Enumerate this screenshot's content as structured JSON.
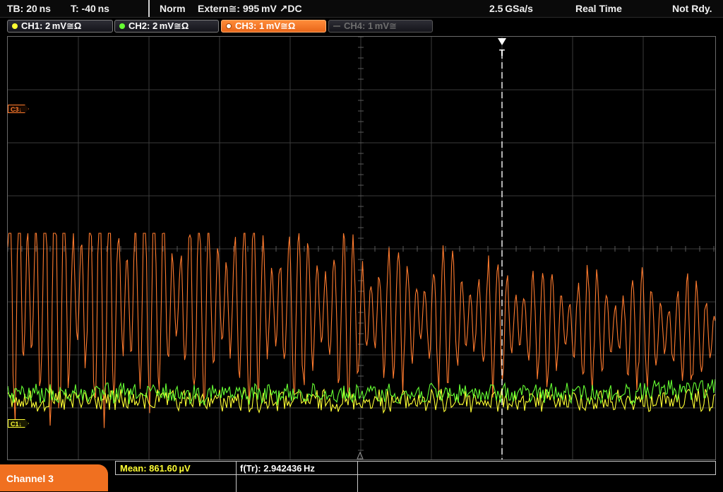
{
  "header": {
    "timebase": "TB: 20 ns",
    "trigger_pos": "T: -40 ns",
    "mode": "Norm",
    "trigger": "Extern≅: 995 mV ↗DC",
    "sample_rate": "2.5 GSa/s",
    "acquisition": "Real Time",
    "status": "Not Rdy."
  },
  "channels": [
    {
      "label": "CH1: 2 mV≅Ω",
      "color": "#ffff33",
      "state": "on"
    },
    {
      "label": "CH2: 2 mV≅Ω",
      "color": "#66ff33",
      "state": "on"
    },
    {
      "label": "CH3: 1 mV≅Ω",
      "color": "#ff8c3a",
      "state": "active"
    },
    {
      "label": "CH4: 1 mV≅",
      "color": "#6e6e6e",
      "state": "off"
    }
  ],
  "markers": {
    "c3": "C3↓",
    "c1": "C1↓",
    "trigger": "T"
  },
  "footer": {
    "channel_tab": "Channel 3",
    "measure1": "Mean: 861.60 µV",
    "measure2": "f(Tr): 2.942436 Hz"
  },
  "colors": {
    "ch1": "#ffff33",
    "ch2": "#66ff33",
    "ch3": "#ff7b2e",
    "grid": "#3a3a3a",
    "accent": "#f07020"
  }
}
